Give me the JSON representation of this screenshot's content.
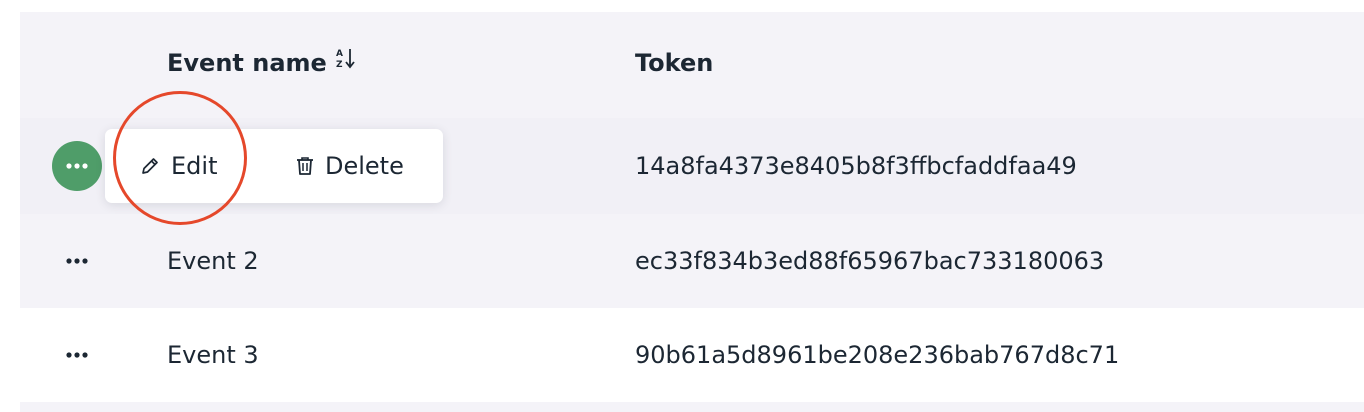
{
  "table": {
    "columns": {
      "event_name": "Event name",
      "token": "Token"
    },
    "rows": [
      {
        "event_name": "",
        "token": "14a8fa4373e8405b8f3ffbcfaddfaa49"
      },
      {
        "event_name": "Event 2",
        "token": "ec33f834b3ed88f65967bac733180063"
      },
      {
        "event_name": "Event 3",
        "token": "90b61a5d8961be208e236bab767d8c71"
      }
    ]
  },
  "row_menu": {
    "edit_label": "Edit",
    "delete_label": "Delete"
  },
  "icons": {
    "sort": "sort-alpha-icon",
    "more": "more-horizontal-icon",
    "edit": "pencil-icon",
    "delete": "trash-icon"
  },
  "colors": {
    "accent": "#4f9d69",
    "highlight": "#e5482b",
    "text": "#1c2733"
  }
}
